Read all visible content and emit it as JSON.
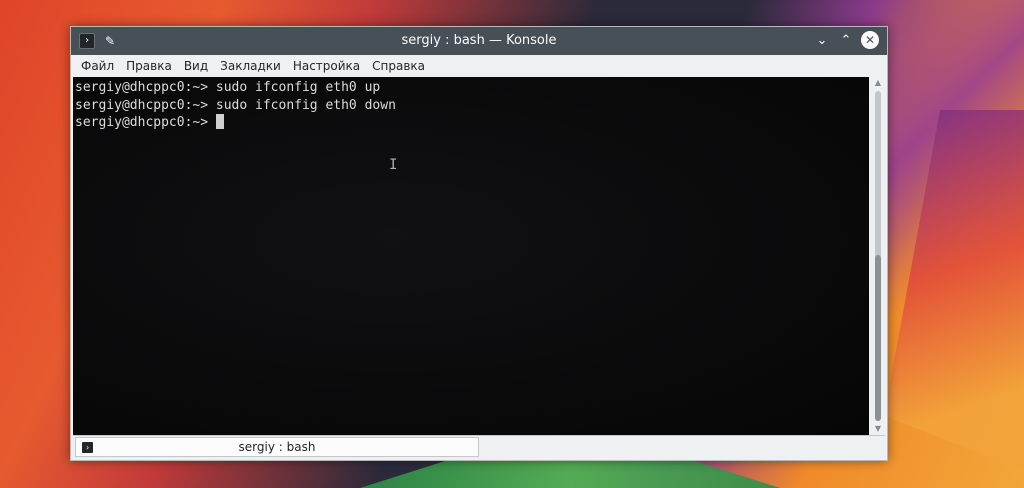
{
  "window": {
    "title": "sergiy : bash — Konsole",
    "icons": {
      "app": "terminal-icon",
      "pin": "pin-icon",
      "minimize": "chevron-down-icon",
      "maximize": "chevron-up-icon",
      "close": "close-icon"
    },
    "glyphs": {
      "app": "›",
      "pin": "✎",
      "minimize": "⌄",
      "maximize": "⌃",
      "close": "✕"
    }
  },
  "menubar": {
    "items": [
      "Файл",
      "Правка",
      "Вид",
      "Закладки",
      "Настройка",
      "Справка"
    ]
  },
  "terminal": {
    "lines": [
      "sergiy@dhcppc0:~> sudo ifconfig eth0 up",
      "sergiy@dhcppc0:~> sudo ifconfig eth0 down"
    ],
    "prompt": "sergiy@dhcppc0:~> ",
    "ibeam_glyph": "I"
  },
  "scrollbar": {
    "up_glyph": "▲",
    "down_glyph": "▼"
  },
  "tabs": [
    {
      "label": "sergiy : bash",
      "icon": "terminal-icon",
      "icon_glyph": "›"
    }
  ],
  "colors": {
    "titlebar": "#475057",
    "terminal_bg": "#0a0a0b",
    "terminal_fg": "#dcdcdc",
    "chrome": "#eff0f1"
  }
}
